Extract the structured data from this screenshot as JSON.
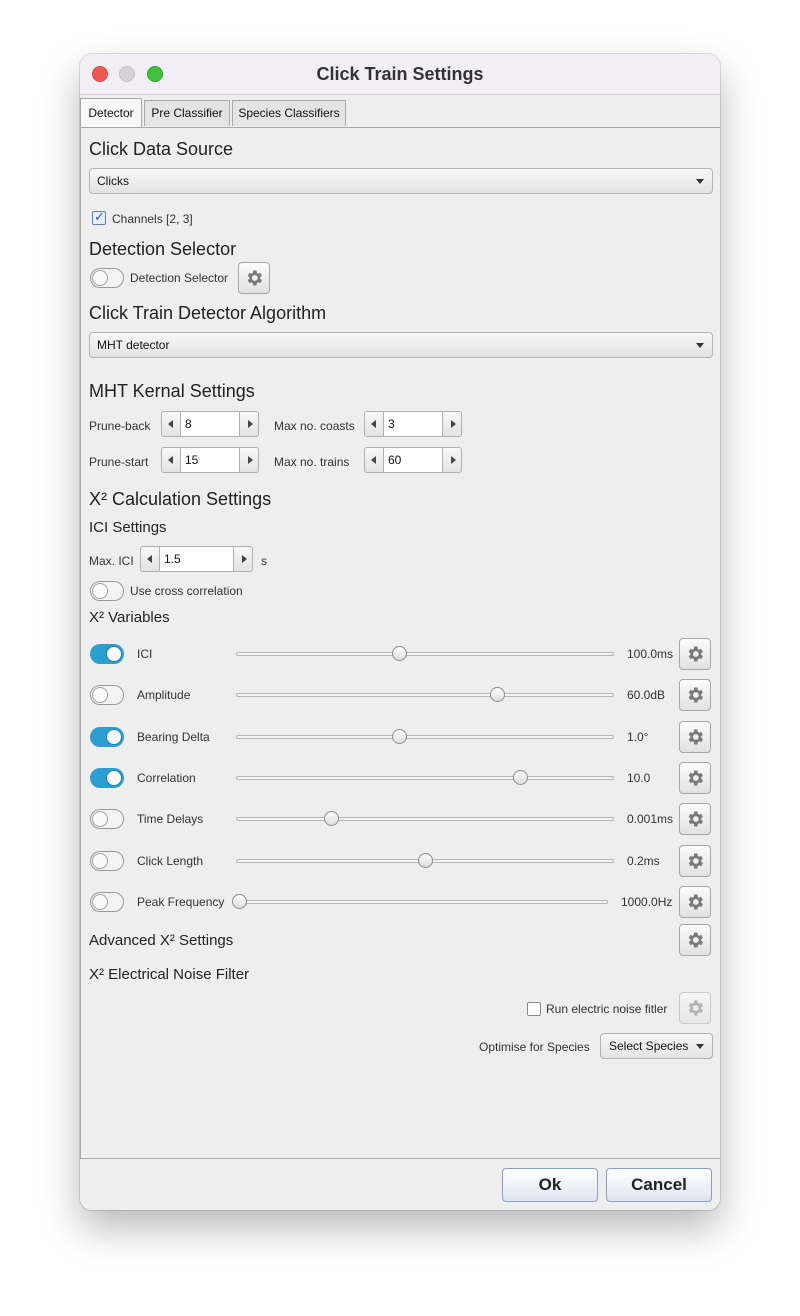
{
  "window": {
    "title": "Click Train Settings"
  },
  "tabs": [
    {
      "label": "Detector",
      "active": true
    },
    {
      "label": "Pre Classifier",
      "active": false
    },
    {
      "label": "Species Classifiers",
      "active": false
    }
  ],
  "data_source": {
    "heading": "Click Data Source",
    "selected": "Clicks",
    "channels_label": "Channels [2, 3]",
    "channels_checked": true
  },
  "detection_selector": {
    "heading": "Detection Selector",
    "toggle_label": "Detection Selector",
    "enabled": false
  },
  "algorithm": {
    "heading": "Click Train Detector Algorithm",
    "selected": "MHT detector"
  },
  "mht": {
    "heading": "MHT Kernal Settings",
    "prune_back_label": "Prune-back",
    "prune_back": "8",
    "prune_start_label": "Prune-start",
    "prune_start": "15",
    "max_coasts_label": "Max no. coasts",
    "max_coasts": "3",
    "max_trains_label": "Max no. trains",
    "max_trains": "60"
  },
  "chi2": {
    "heading": "X² Calculation Settings",
    "ici_heading": "ICI Settings",
    "max_ici_label": "Max. ICI",
    "max_ici": "1.5",
    "max_ici_unit": "s",
    "cross_corr_label": "Use cross correlation",
    "cross_corr_enabled": false,
    "variables_heading": "X² Variables",
    "variables": [
      {
        "label": "ICI",
        "enabled": true,
        "value": "100.0ms",
        "position": 0.43
      },
      {
        "label": "Amplitude",
        "enabled": false,
        "value": "60.0dB",
        "position": 0.69
      },
      {
        "label": "Bearing Delta",
        "enabled": true,
        "value": "1.0°",
        "position": 0.43
      },
      {
        "label": "Correlation",
        "enabled": true,
        "value": "10.0",
        "position": 0.75
      },
      {
        "label": "Time Delays",
        "enabled": false,
        "value": "0.001ms",
        "position": 0.25
      },
      {
        "label": "Click Length",
        "enabled": false,
        "value": "0.2ms",
        "position": 0.5
      },
      {
        "label": "Peak Frequency",
        "enabled": false,
        "value": "1000.0Hz",
        "position": 0.0
      }
    ],
    "advanced_label": "Advanced X² Settings",
    "noise_heading": "X² Electrical Noise Filter",
    "run_noise_label": "Run electric noise fitler",
    "run_noise_checked": false,
    "optimise_label": "Optimise for Species",
    "select_species": "Select Species"
  },
  "footer": {
    "ok": "Ok",
    "cancel": "Cancel"
  },
  "colors": {
    "toggle_on": "#2b9fd0",
    "panel_bg": "#eeeeee"
  }
}
